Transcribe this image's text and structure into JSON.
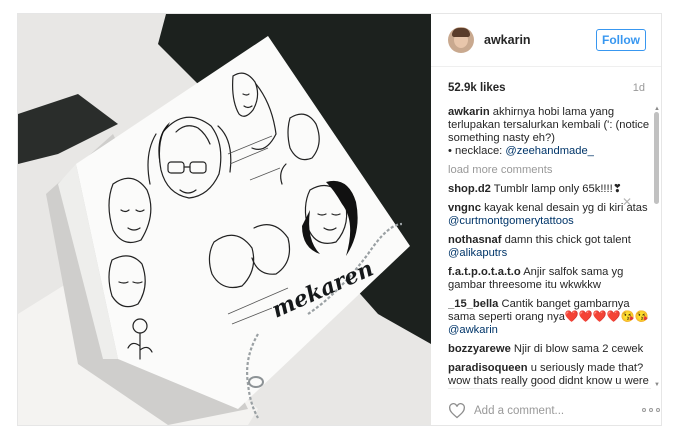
{
  "post": {
    "username": "awkarin",
    "follow_label": "Follow",
    "likes": "52.9k likes",
    "time": "1d",
    "caption": {
      "user": "awkarin",
      "text": "akhirnya hobi lama yang terlupakan tersalurkan kembali (': (notice something nasty eh?)",
      "line2_prefix": "• necklace: ",
      "mention": "@zeehandmade_"
    },
    "load_more": "load more comments",
    "comments": [
      {
        "user": "shop.d2",
        "text": "Tumblr lamp only 65k!!!!❣",
        "mention": ""
      },
      {
        "user": "vngnc",
        "text": "kayak kenal desain yg di kiri atas",
        "mention": "@curtmontgomerytattoos"
      },
      {
        "user": "nothasnaf",
        "text": "damn this chick got talent",
        "mention": "@alikaputrs"
      },
      {
        "user": "f.a.t.p.o.t.a.t.o",
        "text": "Anjir salfok sama yg gambar threesome itu wkwkkw",
        "mention": ""
      },
      {
        "user": "_15_bella",
        "text": "Cantik banget gambarnya sama seperti orang nya❤️❤️❤️❤️😘😘",
        "mention": "@awkarin"
      },
      {
        "user": "bozzyarewe",
        "text": "Njir di blow sama 2 cewek",
        "mention": ""
      },
      {
        "user": "paradisoqueen",
        "text": "u seriously made that? wow thats really good didnt know u were very artistic :)",
        "mention": ""
      }
    ],
    "comment_placeholder": "Add a comment...",
    "necklace_text": "mekaren"
  },
  "icons": {
    "like": "heart-icon",
    "options": "more-options-icon",
    "delete": "close-icon"
  },
  "colors": {
    "accent": "#3897f0",
    "mention": "#003569",
    "muted": "#999999"
  }
}
